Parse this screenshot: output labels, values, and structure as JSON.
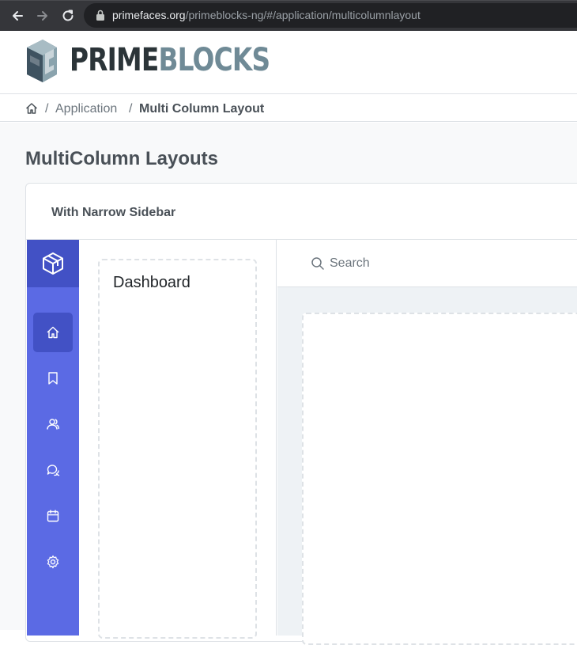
{
  "browser": {
    "url_host": "primefaces.org",
    "url_path": "/primeblocks-ng/#/application/multicolumnlayout"
  },
  "brand": {
    "name_part1": "PRIME",
    "name_part2": "BLOCKS"
  },
  "breadcrumb": {
    "items": [
      "Application",
      "Multi Column Layout"
    ],
    "separator": "/"
  },
  "page": {
    "title": "MultiColumn Layouts"
  },
  "card": {
    "title": "With Narrow Sidebar"
  },
  "narrow_sidebar": {
    "items": [
      {
        "icon": "home-icon",
        "active": true
      },
      {
        "icon": "bookmark-icon",
        "active": false
      },
      {
        "icon": "users-icon",
        "active": false
      },
      {
        "icon": "comments-icon",
        "active": false
      },
      {
        "icon": "calendar-icon",
        "active": false
      },
      {
        "icon": "cog-icon",
        "active": false
      }
    ]
  },
  "secondary": {
    "title": "Dashboard"
  },
  "search": {
    "placeholder": "Search"
  },
  "colors": {
    "sidebar": "#5b6ae4",
    "sidebar_active": "#4251c5",
    "brand_dark": "#2b3438",
    "brand_light": "#6f8a96"
  }
}
